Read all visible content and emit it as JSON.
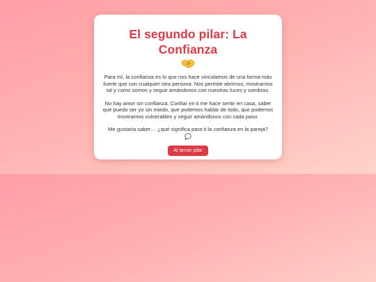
{
  "card": {
    "title": "El segundo pilar: La Confianza",
    "title_emoji": "handshake-icon",
    "paragraphs": [
      "Para mí, la confianza es lo que nos hace vinculamos de una forma más fuerte que con cualquier otra persona. Nos permite abrirnos, mostrarnos tal y como somos y seguir amándonos con nuestras luces y sombras.",
      "No hay amor sin confianza. Confiar en ti me hace sentir en casa, saber que puedo ser yo sin miedo, que podemos hablar de todo, que podemos mostrarnos vulnerables y seguir amándonos con cada paso.",
      "Me gustaría saber… ¿qué significa para ti la confianza en la pareja?"
    ],
    "question_icon": "speech-bubble-icon",
    "button_label": "Al tercer pilar"
  },
  "colors": {
    "accent": "#dc3b45",
    "background_start": "#ff9ea3",
    "background_end": "#ffd3c8",
    "card_background": "#ffffff",
    "text": "#333333"
  }
}
